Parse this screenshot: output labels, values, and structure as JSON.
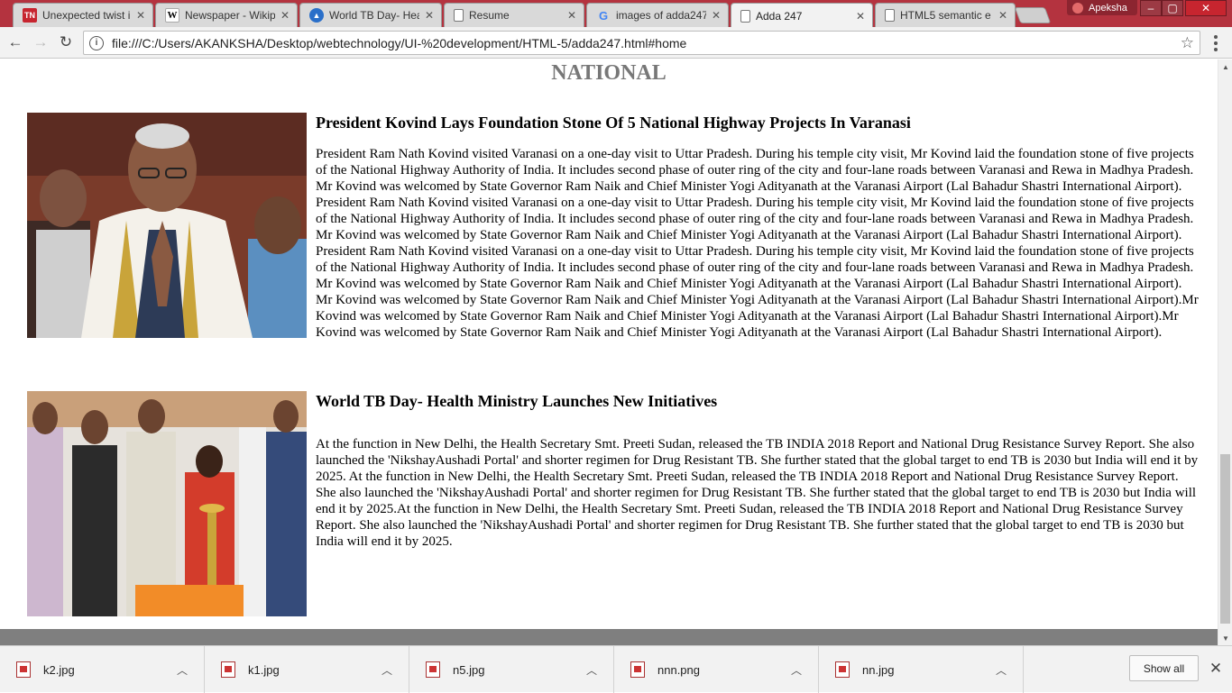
{
  "browser": {
    "tabs": [
      {
        "favicon": "TN",
        "title": "Unexpected twist in",
        "active": false
      },
      {
        "favicon": "W",
        "title": "Newspaper - Wikip",
        "active": false
      },
      {
        "favicon": "TB",
        "title": "World TB Day- Hea",
        "active": false
      },
      {
        "favicon": "",
        "title": "Resume",
        "active": false
      },
      {
        "favicon": "G",
        "title": "images of adda247",
        "active": false
      },
      {
        "favicon": "",
        "title": "Adda 247",
        "active": true
      },
      {
        "favicon": "",
        "title": "HTML5 semantic e",
        "active": false
      }
    ],
    "profile_name": "Apeksha",
    "url": "file:///C:/Users/AKANKSHA/Desktop/webtechnology/UI-%20development/HTML-5/adda247.html#home"
  },
  "page": {
    "section_title": "NATIONAL",
    "articles": [
      {
        "headline": "President Kovind Lays Foundation Stone Of 5 National Highway Projects In Varanasi",
        "body": "President Ram Nath Kovind visited Varanasi on a one-day visit to Uttar Pradesh. During his temple city visit, Mr Kovind laid the foundation stone of five projects of the National Highway Authority of India. It includes second phase of outer ring of the city and four-lane roads between Varanasi and Rewa in Madhya Pradesh. Mr Kovind was welcomed by State Governor Ram Naik and Chief Minister Yogi Adityanath at the Varanasi Airport (Lal Bahadur Shastri International Airport). President Ram Nath Kovind visited Varanasi on a one-day visit to Uttar Pradesh. During his temple city visit, Mr Kovind laid the foundation stone of five projects of the National Highway Authority of India. It includes second phase of outer ring of the city and four-lane roads between Varanasi and Rewa in Madhya Pradesh. Mr Kovind was welcomed by State Governor Ram Naik and Chief Minister Yogi Adityanath at the Varanasi Airport (Lal Bahadur Shastri International Airport). President Ram Nath Kovind visited Varanasi on a one-day visit to Uttar Pradesh. During his temple city visit, Mr Kovind laid the foundation stone of five projects of the National Highway Authority of India. It includes second phase of outer ring of the city and four-lane roads between Varanasi and Rewa in Madhya Pradesh. Mr Kovind was welcomed by State Governor Ram Naik and Chief Minister Yogi Adityanath at the Varanasi Airport (Lal Bahadur Shastri International Airport). Mr Kovind was welcomed by State Governor Ram Naik and Chief Minister Yogi Adityanath at the Varanasi Airport (Lal Bahadur Shastri International Airport).Mr Kovind was welcomed by State Governor Ram Naik and Chief Minister Yogi Adityanath at the Varanasi Airport (Lal Bahadur Shastri International Airport).Mr Kovind was welcomed by State Governor Ram Naik and Chief Minister Yogi Adityanath at the Varanasi Airport (Lal Bahadur Shastri International Airport)."
      },
      {
        "headline": "World TB Day- Health Ministry Launches New Initiatives",
        "body": "At the function in New Delhi, the Health Secretary Smt. Preeti Sudan, released the TB INDIA 2018 Report and National Drug Resistance Survey Report. She also launched the 'NikshayAushadi Portal' and shorter regimen for Drug Resistant TB. She further stated that the global target to end TB is 2030 but India will end it by 2025. At the function in New Delhi, the Health Secretary Smt. Preeti Sudan, released the TB INDIA 2018 Report and National Drug Resistance Survey Report. She also launched the 'NikshayAushadi Portal' and shorter regimen for Drug Resistant TB. She further stated that the global target to end TB is 2030 but India will end it by 2025.At the function in New Delhi, the Health Secretary Smt. Preeti Sudan, released the TB INDIA 2018 Report and National Drug Resistance Survey Report. She also launched the 'NikshayAushadi Portal' and shorter regimen for Drug Resistant TB. She further stated that the global target to end TB is 2030 but India will end it by 2025."
      }
    ]
  },
  "downloads": {
    "items": [
      "k2.jpg",
      "k1.jpg",
      "n5.jpg",
      "nnn.png",
      "nn.jpg"
    ],
    "show_all_label": "Show all"
  },
  "colors": {
    "tabstrip": "#b4333f",
    "section_title": "#777777",
    "footer_bar": "#7f7f7f"
  }
}
